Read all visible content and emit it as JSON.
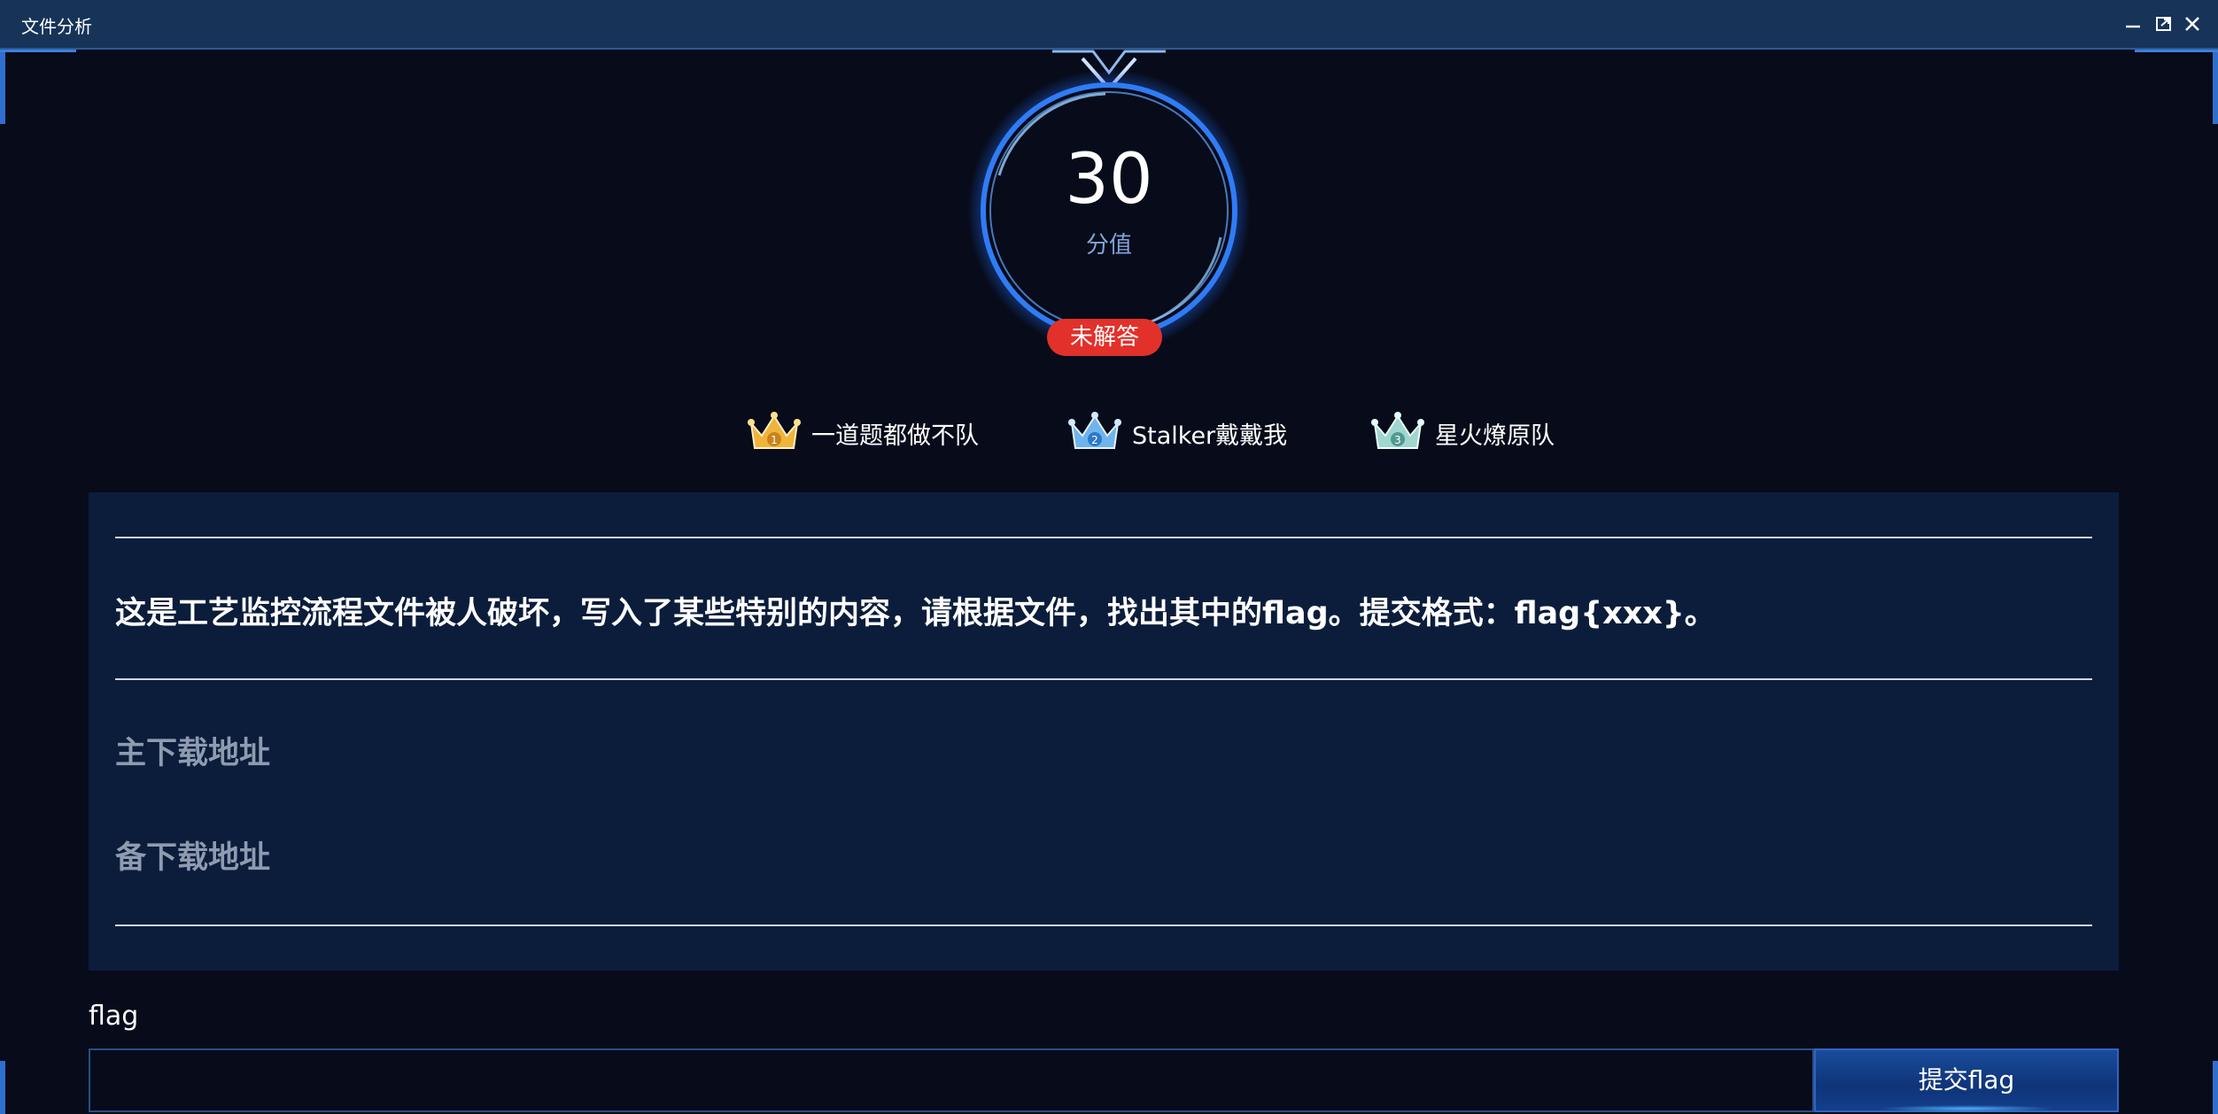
{
  "window": {
    "title": "文件分析"
  },
  "challenge": {
    "score": "30",
    "score_label": "分值",
    "status": "未解答",
    "description": "这是工艺监控流程文件被人破坏，写入了某些特别的内容，请根据文件，找出其中的flag。提交格式：flag{xxx}。",
    "download_main": "主下载地址",
    "download_backup": "备下载地址"
  },
  "rankings": [
    {
      "rank": "1",
      "team": "一道题都做不队",
      "icon": "gold-crown-icon",
      "color": "#f0b43c"
    },
    {
      "rank": "2",
      "team": "Stalker戴戴我",
      "icon": "blue-crown-icon",
      "color": "#6fb4ec"
    },
    {
      "rank": "3",
      "team": "星火燎原队",
      "icon": "teal-crown-icon",
      "color": "#9fd6cf"
    }
  ],
  "flag_form": {
    "label": "flag",
    "input_value": "",
    "submit_label": "提交flag"
  },
  "colors": {
    "background": "#070b1a",
    "titlebar": "#173458",
    "panel": "#0b1d3b",
    "status_badge": "#e2312a",
    "ring": "#2f7cf6"
  }
}
